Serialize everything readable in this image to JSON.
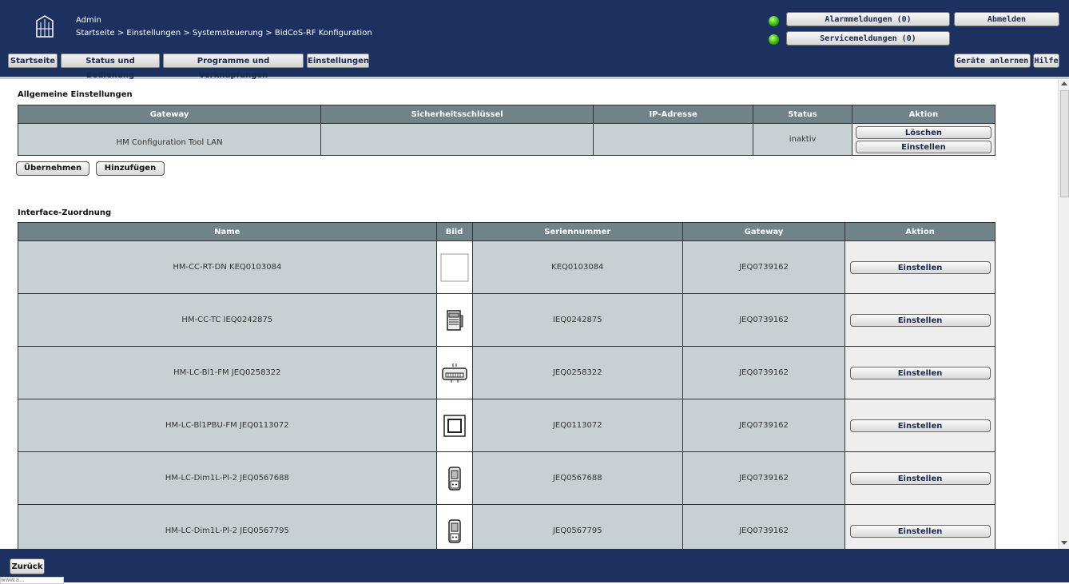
{
  "header": {
    "user": "Admin",
    "breadcrumb": "Startseite > Einstellungen > Systemsteuerung > BidCoS-RF Konfiguration",
    "nav": [
      "Startseite",
      "Status und Bedienung",
      "Programme und Verknüpfungen",
      "Einstellungen"
    ],
    "alarm_label": "Alarmmeldungen (0)",
    "service_label": "Servicemeldungen (0)",
    "logout_label": "Abmelden",
    "teach_label": "Geräte anlernen",
    "help_label": "Hilfe",
    "led_color": "#31b000"
  },
  "general": {
    "title": "Allgemeine Einstellungen",
    "columns": [
      "Gateway",
      "Sicherheitsschlüssel",
      "IP-Adresse",
      "Status",
      "Aktion"
    ],
    "row": {
      "gateway": "HM Configuration Tool LAN",
      "key": "",
      "ip": "",
      "status": "inaktiv",
      "delete_label": "Löschen",
      "config_label": "Einstellen"
    },
    "apply_label": "Übernehmen",
    "add_label": "Hinzufügen"
  },
  "interfaces": {
    "title": "Interface-Zuordnung",
    "columns": [
      "Name",
      "Bild",
      "Seriennummer",
      "Gateway",
      "Aktion"
    ],
    "rows": [
      {
        "name": "HM-CC-RT-DN KEQ0103084",
        "image": "blank-device-icon",
        "serial": "KEQ0103084",
        "gateway": "JEQ0739162",
        "action": "Einstellen"
      },
      {
        "name": "HM-CC-TC IEQ0242875",
        "image": "thermostat-device-icon",
        "serial": "IEQ0242875",
        "gateway": "JEQ0739162",
        "action": "Einstellen"
      },
      {
        "name": "HM-LC-Bl1-FM JEQ0258322",
        "image": "flush-actuator-icon",
        "serial": "JEQ0258322",
        "gateway": "JEQ0739162",
        "action": "Einstellen"
      },
      {
        "name": "HM-LC-Bl1PBU-FM JEQ0113072",
        "image": "wall-switch-icon",
        "serial": "JEQ0113072",
        "gateway": "JEQ0739162",
        "action": "Einstellen"
      },
      {
        "name": "HM-LC-Dim1L-Pl-2 JEQ0567688",
        "image": "plug-dimmer-icon",
        "serial": "JEQ0567688",
        "gateway": "JEQ0739162",
        "action": "Einstellen"
      },
      {
        "name": "HM-LC-Dim1L-Pl-2 JEQ0567795",
        "image": "plug-dimmer-icon",
        "serial": "JEQ0567795",
        "gateway": "JEQ0739162",
        "action": "Einstellen"
      }
    ]
  },
  "footer": {
    "back_label": "Zurück",
    "status_url": "www.a..."
  }
}
